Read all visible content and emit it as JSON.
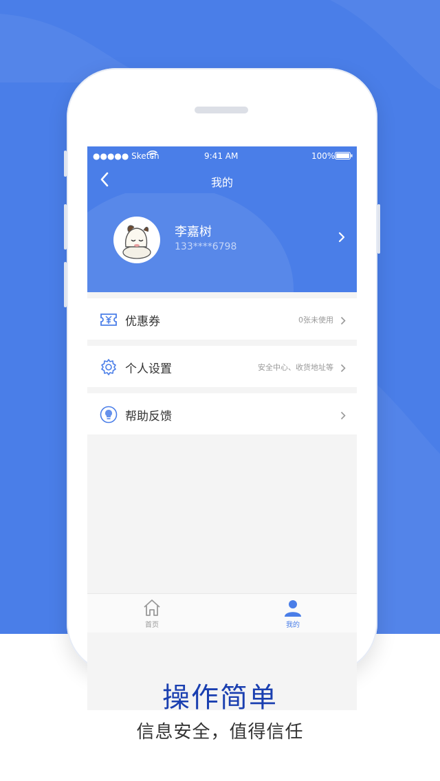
{
  "status_bar": {
    "carrier": "●●●●● Sketch",
    "time": "9:41 AM",
    "battery": "100%"
  },
  "navbar": {
    "title": "我的"
  },
  "profile": {
    "name": "李嘉树",
    "phone": "133****6798"
  },
  "menu": [
    {
      "icon": "coupon-icon",
      "label": "优惠券",
      "hint": "0张未使用"
    },
    {
      "icon": "gear-icon",
      "label": "个人设置",
      "hint": "安全中心、收货地址等"
    },
    {
      "icon": "lightbulb-icon",
      "label": "帮助反馈",
      "hint": ""
    }
  ],
  "tabbar": {
    "tabs": [
      {
        "label": "首页",
        "icon": "home-icon",
        "active": false
      },
      {
        "label": "我的",
        "icon": "user-icon",
        "active": true
      }
    ]
  },
  "caption": {
    "title": "操作简单",
    "subtitle": "信息安全，值得信任"
  },
  "colors": {
    "brand_blue": "#4a7ee8",
    "caption_blue": "#1a3fb0",
    "inactive_tab": "#999999"
  }
}
